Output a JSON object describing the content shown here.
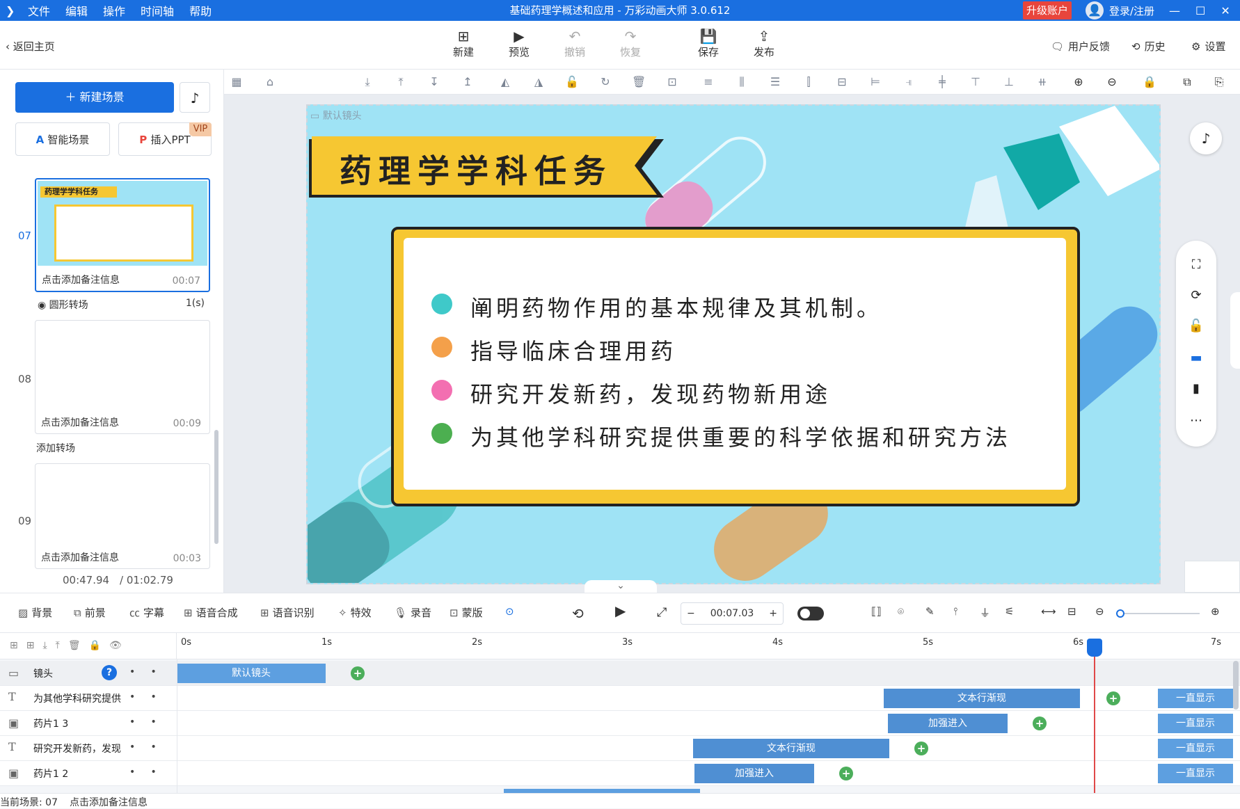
{
  "window": {
    "title": "基础药理学概述和应用 - 万彩动画大师 3.0.612",
    "upgrade": "升级账户",
    "login": "登录/注册",
    "menu": [
      "文件",
      "编辑",
      "操作",
      "时间轴",
      "帮助"
    ]
  },
  "toolbar": {
    "back": "返回主页",
    "buttons": [
      "新建",
      "预览",
      "撤销",
      "恢复",
      "保存",
      "发布"
    ],
    "right": [
      "用户反馈",
      "历史",
      "设置"
    ]
  },
  "left": {
    "new_scene": "新建场景",
    "smart_scene": "智能场景",
    "insert_ppt": "插入PPT",
    "vip": "VIP",
    "scenes": [
      {
        "num": "07",
        "note": "点击添加备注信息",
        "dur": "00:07",
        "thumb_title": "药理学学科任务"
      },
      {
        "num": "08",
        "note": "点击添加备注信息",
        "dur": "00:09"
      },
      {
        "num": "09",
        "note": "点击添加备注信息",
        "dur": "00:03"
      }
    ],
    "transition": {
      "name": "圆形转场",
      "dur": "1(s)"
    },
    "add_transition": "添加转场",
    "time_current": "00:47.94",
    "time_total": "/ 01:02.79"
  },
  "canvas": {
    "camera_label": "默认镜头",
    "banner_title": "药理学学科任务",
    "bullets": [
      "阐明药物作用的基本规律及其机制。",
      "指导临床合理用药",
      "研究开发新药，发现药物新用途",
      "为其他学科研究提供重要的科学依据和研究方法"
    ],
    "bullet_colors": [
      "#3fc9c9",
      "#f4a04a",
      "#f36fb1",
      "#4caf50"
    ]
  },
  "timeline_tools": {
    "items": [
      "背景",
      "前景",
      "字幕",
      "语音合成",
      "语音识别",
      "特效",
      "录音",
      "蒙版"
    ],
    "time": "00:07.03"
  },
  "timeline": {
    "ticks": [
      "0s",
      "1s",
      "2s",
      "3s",
      "4s",
      "5s",
      "6s",
      "7s"
    ],
    "rows": [
      {
        "name": "镜头",
        "blocks": [
          "默认镜头"
        ]
      },
      {
        "name": "为其他学科研究提供",
        "blocks": [
          "文本行渐现",
          "一直显示"
        ]
      },
      {
        "name": "药片1 3",
        "blocks": [
          "加强进入",
          "一直显示"
        ]
      },
      {
        "name": "研究开发新药，发现",
        "blocks": [
          "文本行渐现",
          "一直显示"
        ]
      },
      {
        "name": "药片1 2",
        "blocks": [
          "加强进入",
          "一直显示"
        ]
      }
    ]
  },
  "status": {
    "current_scene": "当前场景: 07",
    "note": "点击添加备注信息"
  }
}
